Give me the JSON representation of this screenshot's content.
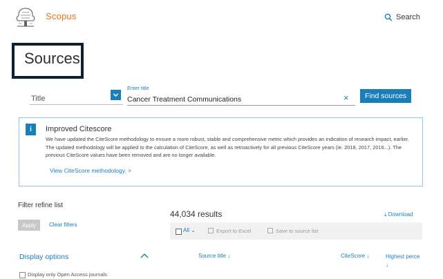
{
  "header": {
    "brand": "Scopus",
    "search_label": "Search"
  },
  "page": {
    "title": "Sources"
  },
  "search_form": {
    "field_label": "Title",
    "enter_title_label": "Enter title",
    "input_value": "Cancer Treatment Communications",
    "clear_symbol": "×",
    "find_button": "Find sources"
  },
  "notice": {
    "heading": "Improved Citescore",
    "body": "We have updated the CiteScore methodology to ensure a more robust, stable and comprehensive metric which provides an indication of research impact, earlier. The updated methodology will be applied to the calculation of CiteScore, as well as retroactively for all previous CiteScore years (ie. 2018, 2017, 2016...). The previous CiteScore values have been removed and are no longer available.",
    "link": "View CiteScore methodology. >"
  },
  "filters": {
    "heading": "Filter refine list",
    "apply": "Apply",
    "clear": "Clear filters",
    "display_options": "Display options",
    "open_access_label": "Display only Open Access journals"
  },
  "results": {
    "count": "44,034 results",
    "download": "Download",
    "all_label": "All",
    "export_excel": "Export to Excel",
    "save_to_list": "Save to source list",
    "col_source_title": "Source title ↓",
    "col_citescore": "CiteScore ↓",
    "col_highest": "Highest perce",
    "col_highest_arrow": "↓"
  },
  "colors": {
    "brand_orange": "#e9711c",
    "accent_blue": "#1a7fb8",
    "title_border": "#0c1f33"
  }
}
